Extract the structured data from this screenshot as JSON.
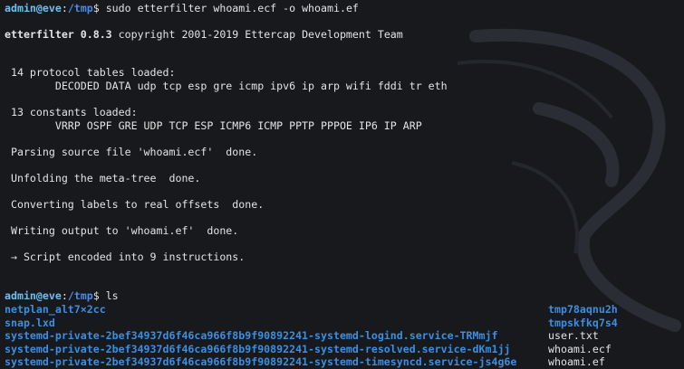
{
  "prompt1": {
    "user": "admin@eve",
    "sep": ":",
    "path": "/tmp",
    "symbol": "$",
    "command": " sudo etterfilter whoami.ecf -o whoami.ef"
  },
  "banner": {
    "name": "etterfilter 0.8.3",
    "rest": " copyright 2001-2019 Ettercap Development Team"
  },
  "output": {
    "protocols": " 14 protocol tables loaded:",
    "protocols_list": "        DECODED DATA udp tcp esp gre icmp ipv6 ip arp wifi fddi tr eth",
    "constants": " 13 constants loaded:",
    "constants_list": "        VRRP OSPF GRE UDP TCP ESP ICMP6 ICMP PPTP PPPOE IP6 IP ARP",
    "parsing": " Parsing source file 'whoami.ecf'  done.",
    "unfolding": " Unfolding the meta-tree  done.",
    "converting": " Converting labels to real offsets  done.",
    "writing": " Writing output to 'whoami.ef'  done.",
    "script": " → Script encoded into 9 instructions."
  },
  "prompt2": {
    "user": "admin@eve",
    "sep": ":",
    "path": "/tmp",
    "symbol": "$",
    "command": " ls"
  },
  "ls": {
    "rows": [
      {
        "left": "netplan_alt7×2cc",
        "left_type": "dir",
        "right": "tmp78aqnu2h",
        "right_type": "dir"
      },
      {
        "left": "snap.lxd",
        "left_type": "dir",
        "right": "tmpskfkq7s4",
        "right_type": "dir"
      },
      {
        "left": "systemd-private-2bef34937d6f46ca966f8b9f90892241-systemd-logind.service-TRMmjf",
        "left_type": "dir",
        "right": "user.txt",
        "right_type": "file"
      },
      {
        "left": "systemd-private-2bef34937d6f46ca966f8b9f90892241-systemd-resolved.service-dKm1jj",
        "left_type": "dir",
        "right": "whoami.ecf",
        "right_type": "file"
      },
      {
        "left": "systemd-private-2bef34937d6f46ca966f8b9f90892241-systemd-timesyncd.service-js4g6e",
        "left_type": "dir",
        "right": "whoami.ef",
        "right_type": "file"
      }
    ]
  },
  "colors": {
    "background": "#17191d",
    "text": "#e3e3e3",
    "user": "#6cc0f0",
    "path": "#4a8de8",
    "directory": "#3b8ee0"
  },
  "icons": {
    "background": "kali-dragon-watermark"
  }
}
